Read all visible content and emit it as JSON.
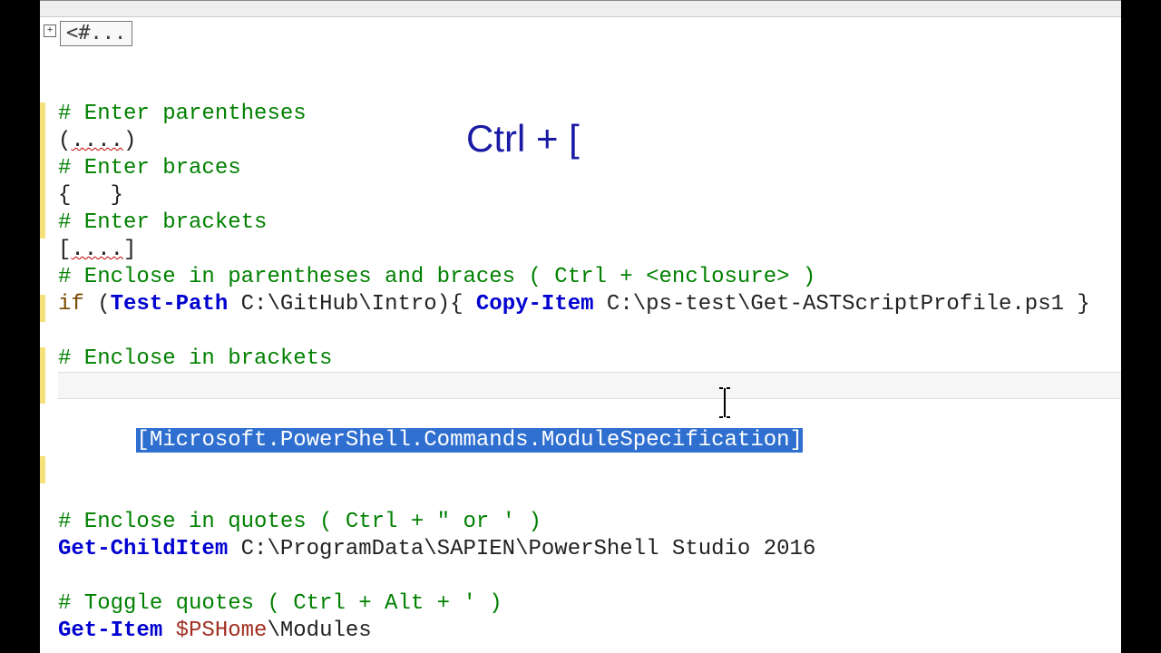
{
  "fold": {
    "symbol": "+",
    "badge": "<#..."
  },
  "overlay": {
    "shortcut": "Ctrl + ["
  },
  "code": {
    "l1": "# Enter parentheses",
    "l2a": "(",
    "l2b": "....",
    "l2c": ")",
    "l3": "# Enter braces",
    "l4a": "{",
    "l4b": "   ",
    "l4c": "}",
    "l5": "# Enter brackets",
    "l6a": "[",
    "l6b": "....",
    "l6c": "]",
    "l7": "# Enclose in parentheses and braces ( Ctrl + <enclosure> )",
    "l8a": "if ",
    "l8b": "(",
    "l8c": "Test-Path",
    "l8d": " C:\\GitHub\\Intro",
    "l8e": ")",
    "l8f": "{ ",
    "l8g": "Copy-Item",
    "l8h": " C:\\ps-test\\Get-ASTScriptProfile.ps1 ",
    "l8i": "}",
    "l10": "# Enclose in brackets",
    "l11_open": "[",
    "l11_sel": "Microsoft.PowerShell.Commands.ModuleSpecification",
    "l11_close": "]",
    "l13": "# Enclose in quotes ( Ctrl + \" or ' )",
    "l14a": "Get-ChildItem",
    "l14b": " C:\\ProgramData\\SAPIEN\\PowerShell Studio 2016",
    "l16": "# Toggle quotes ( Ctrl + Alt + ' )",
    "l17a": "Get-Item",
    "l17b": " ",
    "l17c": "$PSHome",
    "l17d": "\\Modules"
  }
}
